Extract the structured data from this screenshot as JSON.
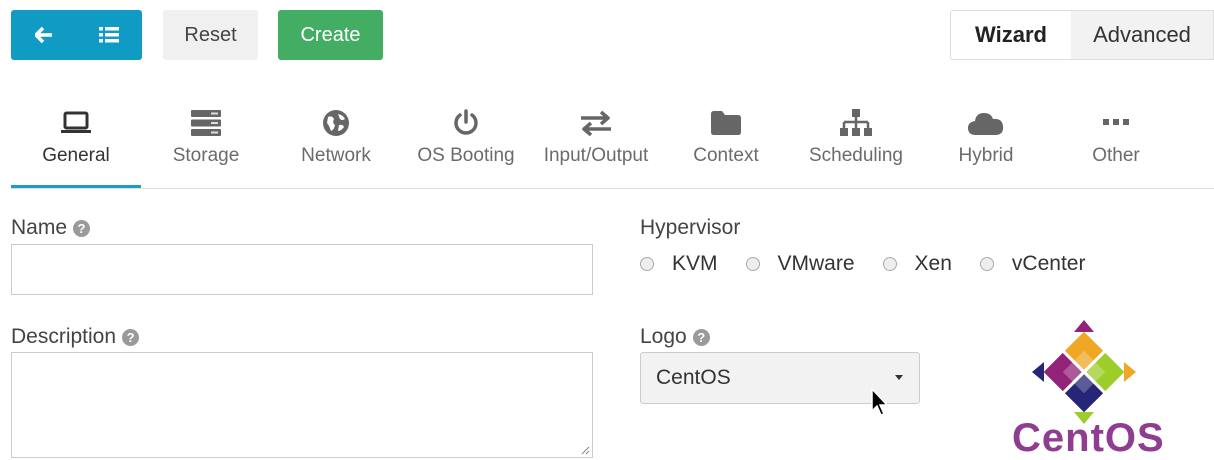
{
  "toolbar": {
    "back_icon": "arrow-left-icon",
    "list_icon": "list-icon",
    "reset_label": "Reset",
    "create_label": "Create",
    "wizard_label": "Wizard",
    "advanced_label": "Advanced"
  },
  "tabs": [
    {
      "label": "General",
      "icon": "laptop-icon",
      "active": true
    },
    {
      "label": "Storage",
      "icon": "server-icon"
    },
    {
      "label": "Network",
      "icon": "globe-icon"
    },
    {
      "label": "OS Booting",
      "icon": "power-icon"
    },
    {
      "label": "Input/Output",
      "icon": "exchange-icon"
    },
    {
      "label": "Context",
      "icon": "folder-icon"
    },
    {
      "label": "Scheduling",
      "icon": "sitemap-icon"
    },
    {
      "label": "Hybrid",
      "icon": "cloud-icon"
    },
    {
      "label": "Other",
      "icon": "ellipsis-icon"
    }
  ],
  "form": {
    "name_label": "Name",
    "name_value": "",
    "description_label": "Description",
    "description_value": "",
    "hypervisor_label": "Hypervisor",
    "hypervisors": [
      "KVM",
      "VMware",
      "Xen",
      "vCenter"
    ],
    "logo_label": "Logo",
    "logo_selected": "CentOS",
    "logo_text": "CentOS"
  },
  "colors": {
    "primary": "#0f9bc4",
    "success": "#43ad63",
    "active_tab_border": "#1a9dc9",
    "centos_purple": "#8e3d91"
  }
}
